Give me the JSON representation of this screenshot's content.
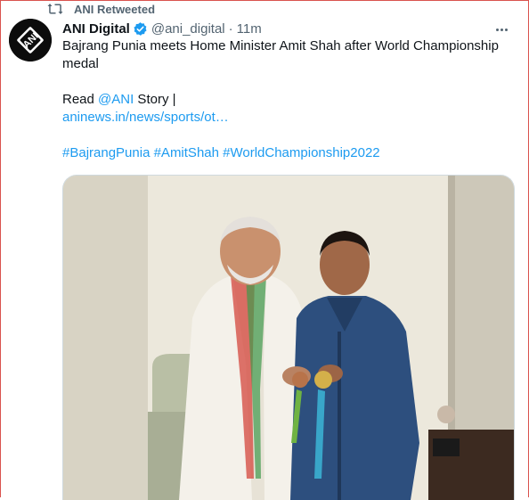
{
  "retweet": {
    "label": "ANI Retweeted",
    "icon": "retweet-icon"
  },
  "author": {
    "display_name": "ANI Digital",
    "handle": "@ani_digital",
    "separator": "·",
    "time": "11m",
    "avatar_text": "ANI",
    "verified_color": "#1d9bf0"
  },
  "tweet": {
    "line1": "Bajrang Punia meets Home Minister Amit Shah after World Championship medal",
    "read_prefix": "Read ",
    "mention": "@ANI",
    "read_suffix": " Story |",
    "url": "aninews.in/news/sports/ot…",
    "hashtags": [
      "#BajrangPunia",
      "#AmitShah",
      "#WorldChampionship2022"
    ]
  },
  "colors": {
    "link": "#1d9bf0",
    "muted": "#536471",
    "text": "#0f1419",
    "frame": "#d9534f"
  }
}
